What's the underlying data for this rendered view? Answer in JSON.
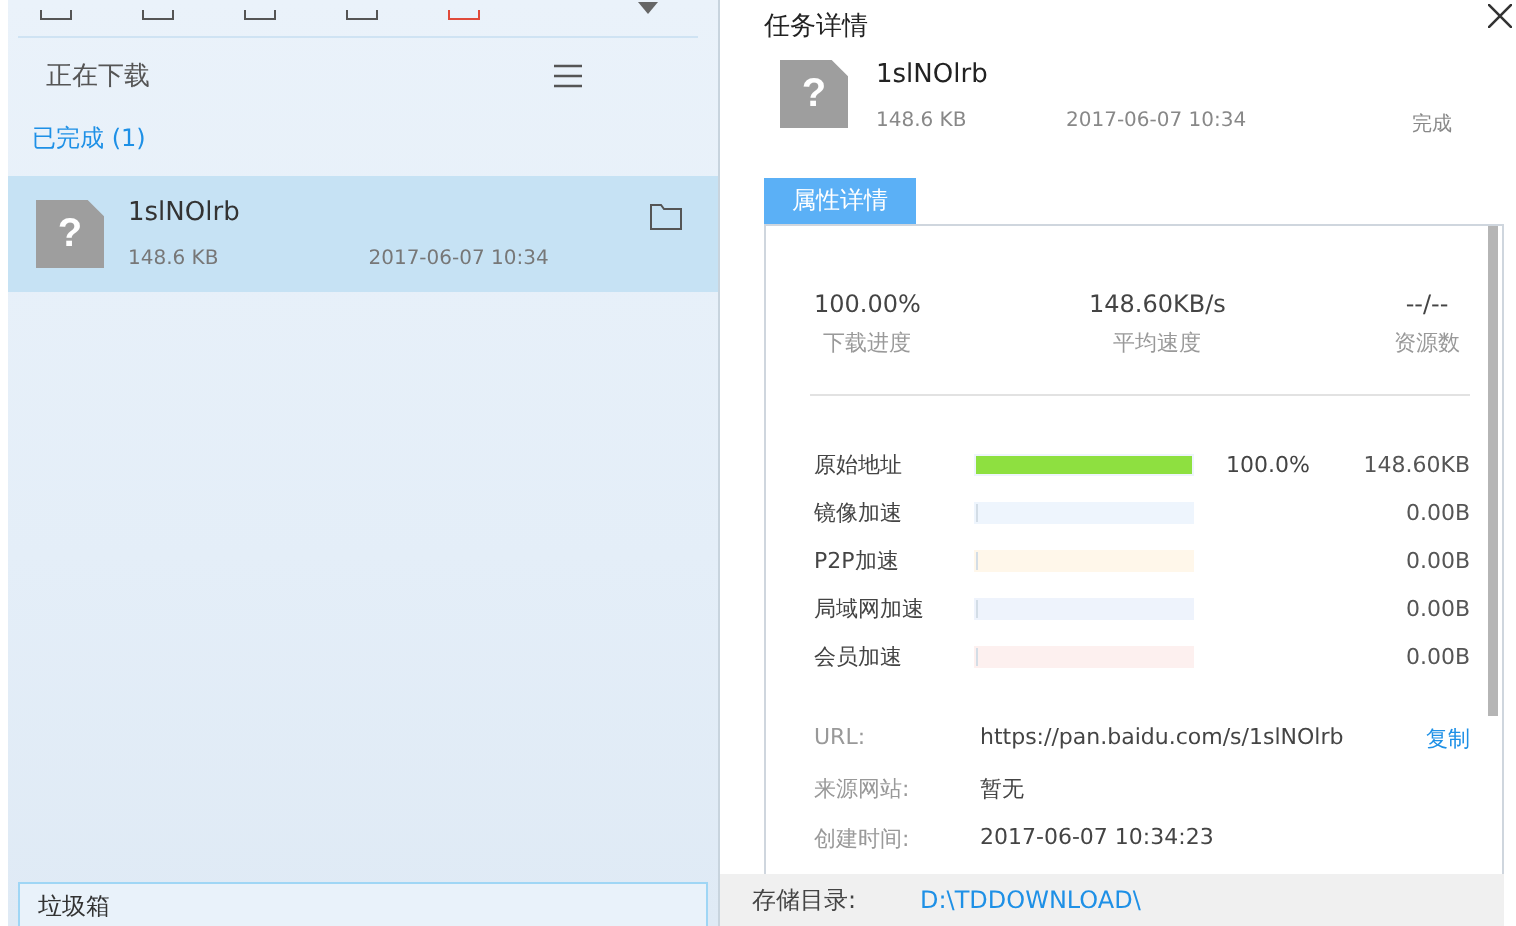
{
  "left_panel": {
    "downloading_label": "正在下载",
    "completed_label": "已完成 (1)",
    "items": [
      {
        "icon": "?",
        "name": "1slNOlrb",
        "size": "148.6 KB",
        "time": "2017-06-07 10:34",
        "selected": true
      }
    ],
    "trash_label": "垃圾箱"
  },
  "detail": {
    "title": "任务详情",
    "file": {
      "icon": "?",
      "name": "1slNOlrb",
      "size": "148.6 KB",
      "time": "2017-06-07 10:34",
      "status": "完成"
    },
    "tabs": [
      {
        "label": "属性详情",
        "selected": true
      }
    ],
    "stats": [
      {
        "value": "100.00%",
        "label": "下载进度"
      },
      {
        "value": "148.60KB/s",
        "label": "平均速度"
      },
      {
        "value": "--/--",
        "label": "资源数"
      }
    ],
    "sources": [
      {
        "name": "原始地址",
        "level": 1,
        "color": "#eef5fd",
        "percent": "100.0%",
        "amount": "148.60KB"
      },
      {
        "name": "镜像加速",
        "level": 0,
        "color": "#eef5fd",
        "amount": "0.00B"
      },
      {
        "name": "P2P加速",
        "level": 0,
        "color": "#fff7ea",
        "amount": "0.00B"
      },
      {
        "name": "局域网加速",
        "level": 0,
        "color": "#eef3fc",
        "amount": "0.00B"
      },
      {
        "name": "会员加速",
        "level": 0,
        "color": "#fdf0ef",
        "amount": "0.00B"
      }
    ],
    "info": [
      {
        "label": "URL:",
        "value": "https://pan.baidu.com/s/1slNOlrb",
        "action": "复制"
      },
      {
        "label": "来源网站:",
        "value": "暂无"
      },
      {
        "label": "创建时间:",
        "value": "2017-06-07 10:34:23"
      }
    ],
    "footer": {
      "label": "存储目录:",
      "path": "D:\\TDDOWNLOAD\\"
    }
  }
}
